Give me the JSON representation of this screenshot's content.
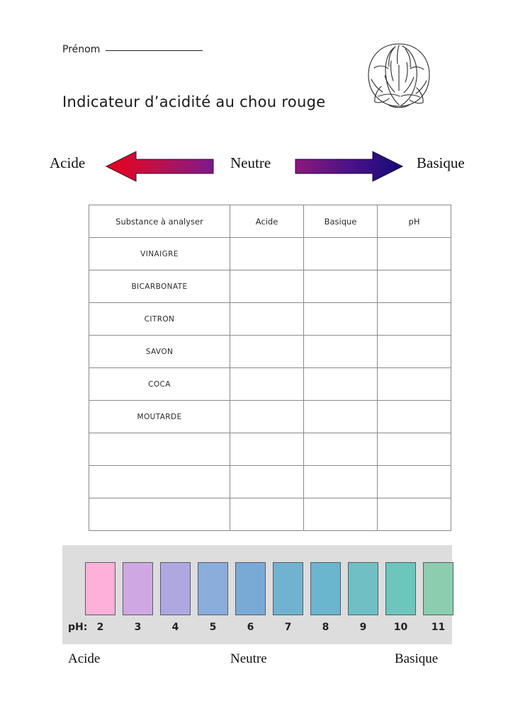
{
  "worksheet": {
    "name_field": {
      "label": "Prénom",
      "value": "",
      "placeholder": ""
    },
    "title": "Indicateur d’acidité au chou rouge",
    "illustration": "red-cabbage-line-drawing"
  },
  "scale_band": {
    "left_label": "Acide",
    "center_label": "Neutre",
    "right_label": "Basique",
    "left_arrow": {
      "direction": "left",
      "gradient_from": "#7b1a8b",
      "gradient_to": "#e8001a"
    },
    "right_arrow": {
      "direction": "right",
      "gradient_from": "#8b1a7b",
      "gradient_to": "#140a78"
    }
  },
  "table": {
    "headers": [
      "Substance à analyser",
      "Acide",
      "Basique",
      "pH"
    ],
    "rows": [
      {
        "substance": "VINAIGRE",
        "acide": "",
        "basique": "",
        "ph": ""
      },
      {
        "substance": "BICARBONATE",
        "acide": "",
        "basique": "",
        "ph": ""
      },
      {
        "substance": "CITRON",
        "acide": "",
        "basique": "",
        "ph": ""
      },
      {
        "substance": "SAVON",
        "acide": "",
        "basique": "",
        "ph": ""
      },
      {
        "substance": "COCA",
        "acide": "",
        "basique": "",
        "ph": ""
      },
      {
        "substance": "MOUTARDE",
        "acide": "",
        "basique": "",
        "ph": ""
      },
      {
        "substance": "",
        "acide": "",
        "basique": "",
        "ph": ""
      },
      {
        "substance": "",
        "acide": "",
        "basique": "",
        "ph": ""
      },
      {
        "substance": "",
        "acide": "",
        "basique": "",
        "ph": ""
      }
    ]
  },
  "ph_scale": {
    "prefix_label": "pH:",
    "panel_background": "#dddddd",
    "swatches": [
      {
        "ph": "2",
        "color": "#ffb0d8"
      },
      {
        "ph": "3",
        "color": "#cfa8e2"
      },
      {
        "ph": "4",
        "color": "#afa8e0"
      },
      {
        "ph": "5",
        "color": "#8aaddb"
      },
      {
        "ph": "6",
        "color": "#79aad6"
      },
      {
        "ph": "7",
        "color": "#70b3d0"
      },
      {
        "ph": "8",
        "color": "#69b6ce"
      },
      {
        "ph": "9",
        "color": "#6fc0c4"
      },
      {
        "ph": "10",
        "color": "#6cc6bc"
      },
      {
        "ph": "11",
        "color": "#8ccdaf"
      }
    ]
  },
  "footer": {
    "left_label": "Acide",
    "center_label": "Neutre",
    "right_label": "Basique"
  }
}
